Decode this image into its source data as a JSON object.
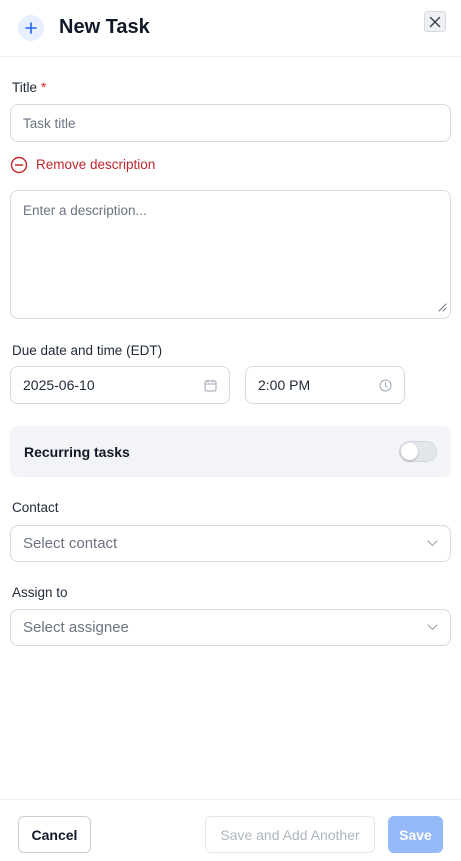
{
  "header": {
    "title": "New Task",
    "icon": "plus-icon",
    "close_icon": "close-icon"
  },
  "form": {
    "title_label": "Title",
    "title_required_mark": "*",
    "title_placeholder": "Task title",
    "remove_description_label": "Remove description",
    "description_placeholder": "Enter a description...",
    "due_label": "Due date and time (EDT)",
    "due_date": "2025-06-10",
    "due_time": "2:00 PM",
    "recurring_label": "Recurring tasks",
    "recurring_enabled": false,
    "contact_label": "Contact",
    "contact_placeholder": "Select contact",
    "assign_label": "Assign to",
    "assign_placeholder": "Select assignee"
  },
  "footer": {
    "cancel_label": "Cancel",
    "save_another_label": "Save and Add Another",
    "save_label": "Save"
  },
  "colors": {
    "accent": "#2563eb",
    "danger": "#c0262d",
    "save_disabled": "#96b9f7",
    "recurring_bg": "#f2f4f7"
  }
}
